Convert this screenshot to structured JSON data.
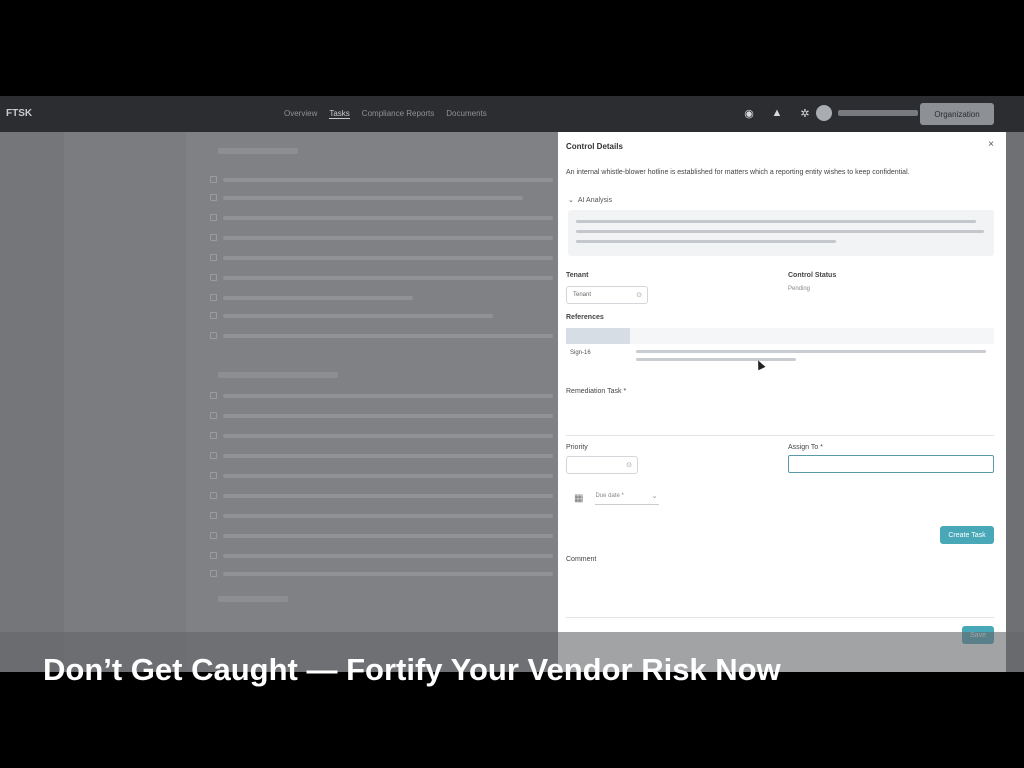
{
  "app": {
    "brand": "FTSK",
    "nav": [
      "Overview",
      "Tasks",
      "Compliance Reports",
      "Documents"
    ],
    "org_button": "Organization"
  },
  "panel": {
    "title": "Control Details",
    "close": "×",
    "description": "An internal whistle-blower hotline is established for matters which a reporting entity wishes to keep confidential.",
    "ai_toggle": "AI Analysis",
    "tenant_label": "Tenant",
    "tenant_value": "Tenant",
    "control_status_label": "Control Status",
    "control_status_value": "Pending",
    "references_label": "References",
    "ref_row_id": "Sign-16",
    "remediation_label": "Remediation Task *",
    "priority_label": "Priority",
    "assign_label": "Assign To *",
    "due_label": "Due date *",
    "create_task_btn": "Create Task",
    "comment_label": "Comment",
    "save_btn": "Save"
  },
  "caption": "Don’t Get Caught — Fortify Your Vendor Risk Now"
}
